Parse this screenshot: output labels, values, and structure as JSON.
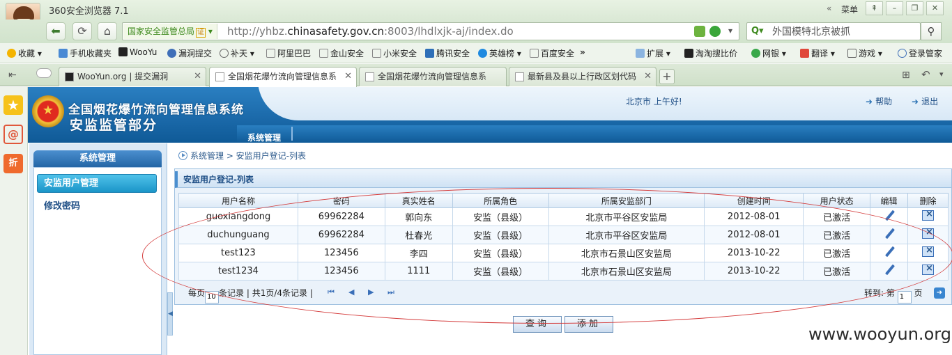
{
  "browser": {
    "title": "360安全浏览器 7.1",
    "menu_label": "菜单",
    "site_name": "国家安全监管总局",
    "cert_badge": "证",
    "url_prefix": "http://yhbz.",
    "url_domain": "chinasafety.gov.cn",
    "url_suffix": ":8003/lhdlxjk-aj/index.do",
    "search_value": "外国模特北京被抓",
    "bookmarks": [
      "收藏",
      "手机收藏夹",
      "WooYu",
      "漏洞提交",
      "补天",
      "阿里巴巴",
      "金山安全",
      "小米安全",
      "腾讯安全",
      "英雄榜",
      "百度安全",
      "扩展",
      "淘淘搜比价",
      "网银",
      "翻译",
      "游戏",
      "登录管家"
    ],
    "tabs": [
      {
        "label": "WooYun.org | 提交漏洞"
      },
      {
        "label": "全国烟花爆竹流向管理信息系"
      },
      {
        "label": "全国烟花爆竹流向管理信息系"
      },
      {
        "label": "最新县及县以上行政区划代码"
      }
    ],
    "side_cart_label": "折"
  },
  "app": {
    "system_title": "全国烟花爆竹流向管理信息系统",
    "system_subtitle": "安监监管部分",
    "greeting": "北京市  上午好!",
    "help_label": "帮助",
    "logout_label": "退出",
    "top_nav": "系统管理",
    "sidebar": {
      "header": "系统管理",
      "items": [
        {
          "label": "安监用户管理"
        },
        {
          "label": "修改密码"
        }
      ]
    },
    "breadcrumb": "系统管理 > 安监用户登记-列表",
    "panel_title": "安监用户登记-列表",
    "table": {
      "columns": [
        "用户名称",
        "密码",
        "真实姓名",
        "所属角色",
        "所属安监部门",
        "创建时间",
        "用户状态",
        "编辑",
        "删除"
      ],
      "rows": [
        {
          "username": "guoxiangdong",
          "password": "69962284",
          "real_name": "郭向东",
          "role": "安监（县级）",
          "dept": "北京市平谷区安监局",
          "created": "2012-08-01",
          "status": "已激活"
        },
        {
          "username": "duchunguang",
          "password": "69962284",
          "real_name": "杜春光",
          "role": "安监（县级）",
          "dept": "北京市平谷区安监局",
          "created": "2012-08-01",
          "status": "已激活"
        },
        {
          "username": "test123",
          "password": "123456",
          "real_name": "李四",
          "role": "安监（县级）",
          "dept": "北京市石景山区安监局",
          "created": "2013-10-22",
          "status": "已激活"
        },
        {
          "username": "test1234",
          "password": "123456",
          "real_name": "1111",
          "role": "安监（县级）",
          "dept": "北京市石景山区安监局",
          "created": "2013-10-22",
          "status": "已激活"
        }
      ]
    },
    "pager": {
      "per_page_prefix": "每页",
      "per_page_value": "10",
      "per_page_suffix": "条记录",
      "summary": "| 共1页/4条记录  |",
      "goto_prefix": "转到: 第",
      "goto_value": "1",
      "goto_suffix": "页"
    },
    "buttons": {
      "query": "查询",
      "add": "添加"
    }
  },
  "watermark": "www.wooyun.org"
}
